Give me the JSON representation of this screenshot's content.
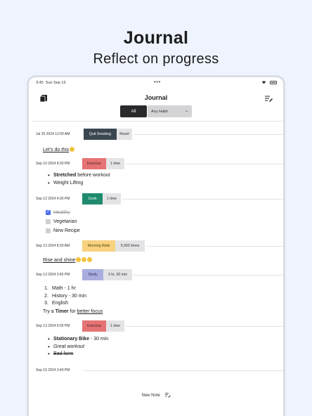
{
  "hero": {
    "title": "Journal",
    "subtitle": "Reflect on progress"
  },
  "status": {
    "time": "3:45",
    "date": "Sun Sep 15",
    "dots": "•••"
  },
  "appbar": {
    "title": "Journal",
    "left_icon": "journal-icon",
    "right_icon": "compose-icon"
  },
  "filters": {
    "all_label": "All",
    "habit_label": "Any Habit",
    "habit_options": [
      "Any Habit"
    ]
  },
  "entries": [
    {
      "date": "Jul 25 2024 12:00 AM",
      "tag": "Quit Smoking",
      "second": "Reset",
      "tag_color": "#3a4750",
      "tag_text_color": "#ffffff",
      "note": "Let's do this"
    },
    {
      "date": "Sep 10 2024 8:30 PM",
      "tag": "Exercise",
      "second": "1 time",
      "tag_color": "#e57373",
      "tag_text_color": "#4a1f1f",
      "bullets": [
        {
          "bold": "Stretched",
          "rest": " before workout"
        },
        {
          "bold": "",
          "rest": "Weight Lifting"
        }
      ]
    },
    {
      "date": "Sep 12 2024 4:30 PM",
      "tag": "Cook",
      "second": "1 time",
      "tag_color": "#1f8a6e",
      "tag_text_color": "#ffffff",
      "checklist": [
        {
          "label": "Healthy",
          "checked": true
        },
        {
          "label": "Vegetarian",
          "checked": false
        },
        {
          "label": "New Recipe",
          "checked": false
        }
      ]
    },
    {
      "date": "Sep 13 2024 8:30 AM",
      "tag": "Morning Walk",
      "second": "5,000 times",
      "tag_color": "#f8d27e",
      "tag_text_color": "#5a4410",
      "note": "Rise and shine"
    },
    {
      "date": "Sep 13 2024 3:45 PM",
      "tag": "Study",
      "second": "2 hr, 30 min",
      "tag_color": "#a9aedf",
      "tag_text_color": "#2a2e5a",
      "olist": [
        "Math - 1 hr",
        "History - 30 min",
        "English"
      ],
      "tail": {
        "pre": "Try a ",
        "bold": "Timer",
        "mid": " for ",
        "link": "better focus"
      }
    },
    {
      "date": "Sep 13 2024 6:00 PM",
      "tag": "Exercise",
      "second": "1 time",
      "tag_color": "#e57373",
      "tag_text_color": "#4a1f1f",
      "rich": {
        "b1": "Stationary Bike",
        "r1": " - 30 min",
        "i2": "Great workout",
        "s3": "Bad form"
      }
    },
    {
      "date": "Sep 15 2024 3:49 PM"
    }
  ],
  "footer": {
    "new_note_label": "New Note"
  }
}
